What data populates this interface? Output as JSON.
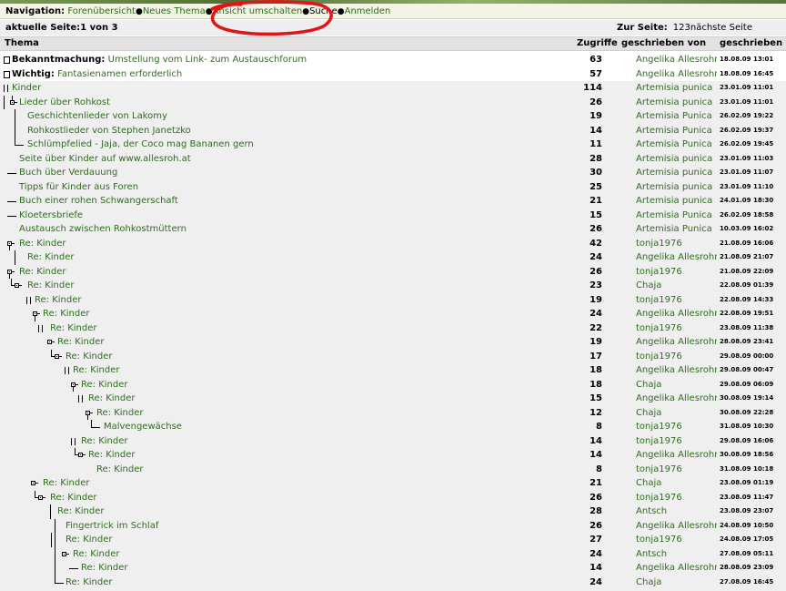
{
  "navigation": {
    "label": "Navigation:",
    "links": [
      "Forenübersicht",
      "Neues Thema",
      "Ansicht umschalten",
      "Suche",
      "Anmelden"
    ],
    "separator": "●"
  },
  "page_info": {
    "current": "aktuelle Seite:1 von 3",
    "goto_label": "Zur Seite:",
    "pages": "123nächste Seite"
  },
  "table": {
    "headers": {
      "topic": "Thema",
      "hits": "Zugriffe",
      "author": "geschrieben von",
      "date": "geschrieben"
    },
    "rows": [
      {
        "prefix": "Bekanntmachung:",
        "title": "Umstellung vom Link- zum Austauschforum",
        "hits": "63",
        "author": "Angelika Allesrohmaus",
        "date": "18.08.09 13:01"
      },
      {
        "prefix": "Wichtig:",
        "title": "Fantasienamen erforderlich",
        "hits": "57",
        "author": "Angelika Allesrohmaus",
        "date": "18.08.09 16:45"
      },
      {
        "prefix": "",
        "title": "Kinder",
        "hits": "114",
        "author": "Artemisia punica",
        "date": "23.01.09 11:01"
      },
      {
        "prefix": "",
        "title": "Lieder über Rohkost",
        "hits": "26",
        "author": "Artemisia punica",
        "date": "23.01.09 11:01"
      },
      {
        "prefix": "",
        "title": "Geschichtenlieder von Lakomy",
        "hits": "19",
        "author": "Artemisia Punica",
        "date": "26.02.09 19:22"
      },
      {
        "prefix": "",
        "title": "Rohkostlieder von Stephen Janetzko",
        "hits": "14",
        "author": "Artemisia Punica",
        "date": "26.02.09 19:37"
      },
      {
        "prefix": "",
        "title": "Schlümpfelied - Jaja, der Coco mag Bananen gern",
        "hits": "11",
        "author": "Artemisia Punica",
        "date": "26.02.09 19:45"
      },
      {
        "prefix": "",
        "title": "Seite über Kinder auf www.allesroh.at",
        "hits": "28",
        "author": "Artemisia punica",
        "date": "23.01.09 11:03"
      },
      {
        "prefix": "",
        "title": "Buch über Verdauung",
        "hits": "30",
        "author": "Artemisia punica",
        "date": "23.01.09 11:07"
      },
      {
        "prefix": "",
        "title": "Tipps für Kinder aus Foren",
        "hits": "25",
        "author": "Artemisia punica",
        "date": "23.01.09 11:10"
      },
      {
        "prefix": "",
        "title": "Buch einer rohen Schwangerschaft",
        "hits": "21",
        "author": "Artemisia punica",
        "date": "24.01.09 18:30"
      },
      {
        "prefix": "",
        "title": "Kloetersbriefe",
        "hits": "15",
        "author": "Artemisia Punica",
        "date": "26.02.09 18:58"
      },
      {
        "prefix": "",
        "title": "Austausch zwischen Rohkostmüttern",
        "hits": "26",
        "author": "Artemisia Punica",
        "date": "10.03.09 16:02"
      },
      {
        "prefix": "",
        "title": "Re: Kinder",
        "hits": "42",
        "author": "tonja1976",
        "date": "21.08.09 16:06"
      },
      {
        "prefix": "",
        "title": "Re: Kinder",
        "hits": "24",
        "author": "Angelika Allesrohmaus",
        "date": "21.08.09 21:07"
      },
      {
        "prefix": "",
        "title": "Re: Kinder",
        "hits": "26",
        "author": "tonja1976",
        "date": "21.08.09 22:09"
      },
      {
        "prefix": "",
        "title": "Re: Kinder",
        "hits": "23",
        "author": "Chaja",
        "date": "22.08.09 01:39"
      },
      {
        "prefix": "",
        "title": "Re: Kinder",
        "hits": "19",
        "author": "tonja1976",
        "date": "22.08.09 14:33"
      },
      {
        "prefix": "",
        "title": "Re: Kinder",
        "hits": "24",
        "author": "Angelika Allesrohmaus",
        "date": "22.08.09 19:51"
      },
      {
        "prefix": "",
        "title": "Re: Kinder",
        "hits": "22",
        "author": "tonja1976",
        "date": "23.08.09 11:38"
      },
      {
        "prefix": "",
        "title": "Re: Kinder",
        "hits": "19",
        "author": "Angelika Allesrohmaus",
        "date": "28.08.09 23:41"
      },
      {
        "prefix": "",
        "title": "Re: Kinder",
        "hits": "17",
        "author": "tonja1976",
        "date": "29.08.09 00:00"
      },
      {
        "prefix": "",
        "title": "Re: Kinder",
        "hits": "18",
        "author": "Angelika Allesrohmaus",
        "date": "29.08.09 00:47"
      },
      {
        "prefix": "",
        "title": "Re: Kinder",
        "hits": "18",
        "author": "Chaja",
        "date": "29.08.09 06:09"
      },
      {
        "prefix": "",
        "title": "Re: Kinder",
        "hits": "15",
        "author": "Angelika Allesrohmaus",
        "date": "30.08.09 19:14"
      },
      {
        "prefix": "",
        "title": "Re: Kinder",
        "hits": "12",
        "author": "Chaja",
        "date": "30.08.09 22:28"
      },
      {
        "prefix": "",
        "title": "Malvengewächse",
        "hits": "8",
        "author": "tonja1976",
        "date": "31.08.09 10:30"
      },
      {
        "prefix": "",
        "title": "Re: Kinder",
        "hits": "14",
        "author": "tonja1976",
        "date": "29.08.09 16:06"
      },
      {
        "prefix": "",
        "title": "Re: Kinder",
        "hits": "14",
        "author": "Angelika Allesrohmaus",
        "date": "30.08.09 18:56"
      },
      {
        "prefix": "",
        "title": "Re: Kinder",
        "hits": "8",
        "author": "tonja1976",
        "date": "31.08.09 10:18"
      },
      {
        "prefix": "",
        "title": "Re: Kinder",
        "hits": "21",
        "author": "Chaja",
        "date": "23.08.09 01:19"
      },
      {
        "prefix": "",
        "title": "Re: Kinder",
        "hits": "26",
        "author": "tonja1976",
        "date": "23.08.09 11:47"
      },
      {
        "prefix": "",
        "title": "Re: Kinder",
        "hits": "28",
        "author": "Antsch",
        "date": "23.08.09 23:07"
      },
      {
        "prefix": "",
        "title": "Fingertrick im Schlaf",
        "hits": "26",
        "author": "Angelika Allesrohmaus",
        "date": "24.08.09 10:50"
      },
      {
        "prefix": "",
        "title": "Re: Kinder",
        "hits": "27",
        "author": "tonja1976",
        "date": "24.08.09 17:05"
      },
      {
        "prefix": "",
        "title": "Re: Kinder",
        "hits": "24",
        "author": "Antsch",
        "date": "27.08.09 05:11"
      },
      {
        "prefix": "",
        "title": "Re: Kinder",
        "hits": "14",
        "author": "Angelika Allesrohmaus",
        "date": "28.08.09 23:09"
      },
      {
        "prefix": "",
        "title": "Re: Kinder",
        "hits": "24",
        "author": "Chaja",
        "date": "27.08.09 16:45"
      }
    ]
  },
  "colors": {
    "link": "#2e6e1e",
    "row_bg": "#efefef",
    "annotation": "#e01515"
  }
}
